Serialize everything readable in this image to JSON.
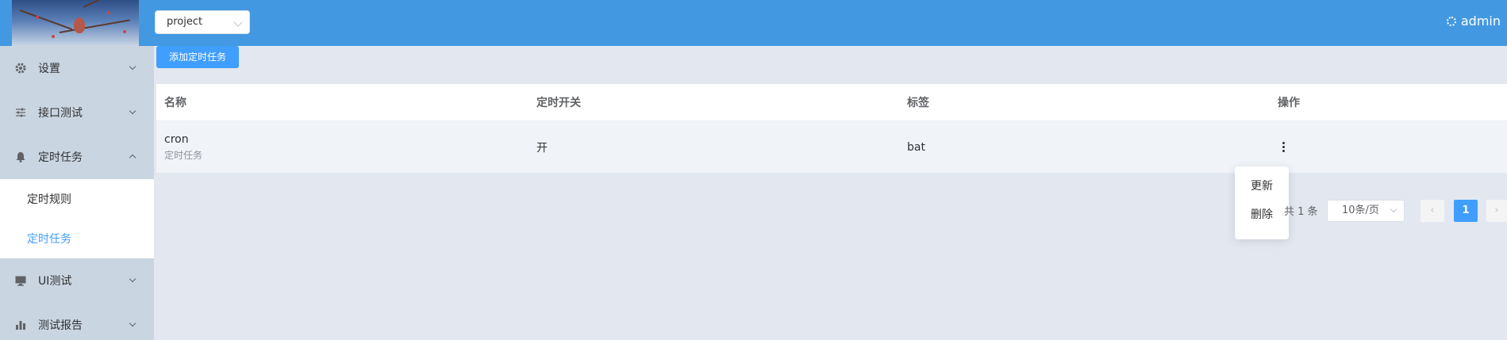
{
  "header": {
    "project_select_value": "project",
    "user_name": "admin"
  },
  "sidebar": {
    "items": [
      {
        "label": "设置",
        "icon": "gear-icon"
      },
      {
        "label": "接口测试",
        "icon": "sliders-icon"
      },
      {
        "label": "定时任务",
        "icon": "bell-icon"
      },
      {
        "label": "UI测试",
        "icon": "monitor-icon"
      },
      {
        "label": "测试报告",
        "icon": "bar-chart-icon"
      }
    ],
    "submenu": [
      {
        "label": "定时规则"
      },
      {
        "label": "定时任务"
      }
    ]
  },
  "main": {
    "add_button_label": "添加定时任务",
    "table": {
      "headers": [
        "名称",
        "定时开关",
        "标签",
        "操作"
      ],
      "rows": [
        {
          "name": "cron",
          "subtitle": "定时任务",
          "switch": "开",
          "tag": "bat"
        }
      ]
    },
    "row_menu": [
      "更新",
      "删除"
    ],
    "pagination": {
      "total_text": "共 1 条",
      "page_size": "10条/页",
      "current_page": "1"
    }
  },
  "colors": {
    "header_bg": "#4299e1",
    "accent": "#409eff",
    "sidebar_bg": "#c9d5e1"
  }
}
